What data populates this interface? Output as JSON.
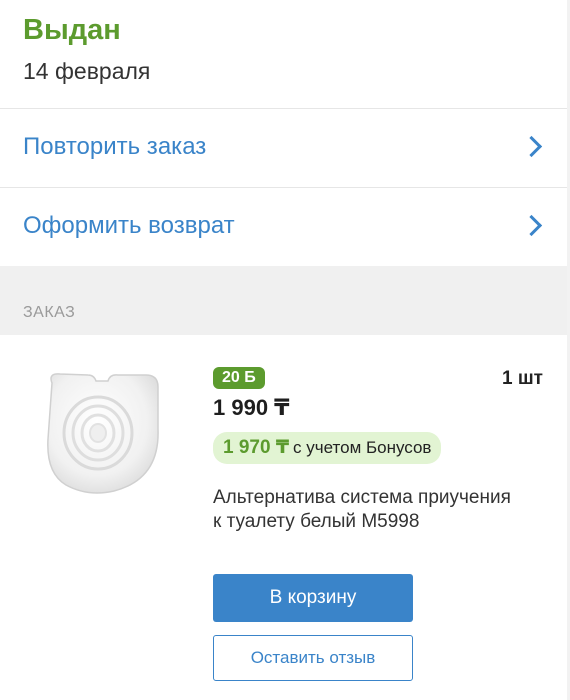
{
  "order_status": {
    "status": "Выдан",
    "date": "14 февраля"
  },
  "actions": [
    {
      "label": "Повторить заказ",
      "icon": "chevron-right-icon"
    },
    {
      "label": "Оформить возврат",
      "icon": "chevron-right-icon"
    }
  ],
  "section": {
    "label": "ЗАКАЗ"
  },
  "product": {
    "bonus_badge": "20 Б",
    "price": "1 990 ₸",
    "bonus_price": "1 970 ₸",
    "bonus_note": "с учетом Бонусов",
    "quantity": "1 шт",
    "title": "Альтернатива система приучения к туалету белый M5998",
    "add_to_cart_label": "В корзину",
    "review_label": "Оставить отзыв",
    "image_icon": "toilet-training-pad-image"
  },
  "colors": {
    "status_green": "#5c9b2e",
    "link_blue": "#3a84c9",
    "bonus_bg": "#e2f4d3",
    "section_bg": "#f0f0f0"
  }
}
